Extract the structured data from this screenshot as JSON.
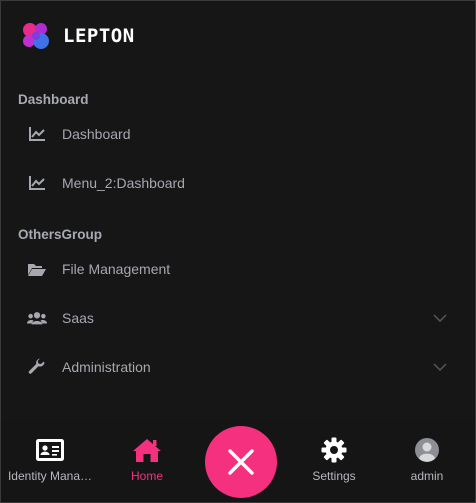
{
  "brand": {
    "name": "LEPTON",
    "logo_colors": [
      "#e62b8a",
      "#8c3fd9",
      "#3f72e6",
      "#c22fd0"
    ]
  },
  "menu": {
    "groups": [
      {
        "title": "Dashboard",
        "items": [
          {
            "label": "Dashboard",
            "icon": "chart-line-icon"
          },
          {
            "label": "Menu_2:Dashboard",
            "icon": "chart-line-icon"
          }
        ]
      },
      {
        "title": "OthersGroup",
        "items": [
          {
            "label": "File Management",
            "icon": "folder-open-icon"
          },
          {
            "label": "Saas",
            "icon": "users-icon",
            "expandable": true
          },
          {
            "label": "Administration",
            "icon": "wrench-icon",
            "expandable": true
          }
        ]
      }
    ]
  },
  "bottom_nav": {
    "tabs": [
      {
        "label": "Identity Mana…",
        "icon": "id-card-icon"
      },
      {
        "label": "Home",
        "icon": "home-icon",
        "active": true
      },
      {
        "label": "Settings",
        "icon": "gear-icon"
      },
      {
        "label": "admin",
        "icon": "avatar-icon"
      }
    ],
    "fab_icon": "close-icon"
  },
  "colors": {
    "accent": "#f5317f",
    "background": "#161616",
    "text_muted": "#a6a8b0"
  }
}
